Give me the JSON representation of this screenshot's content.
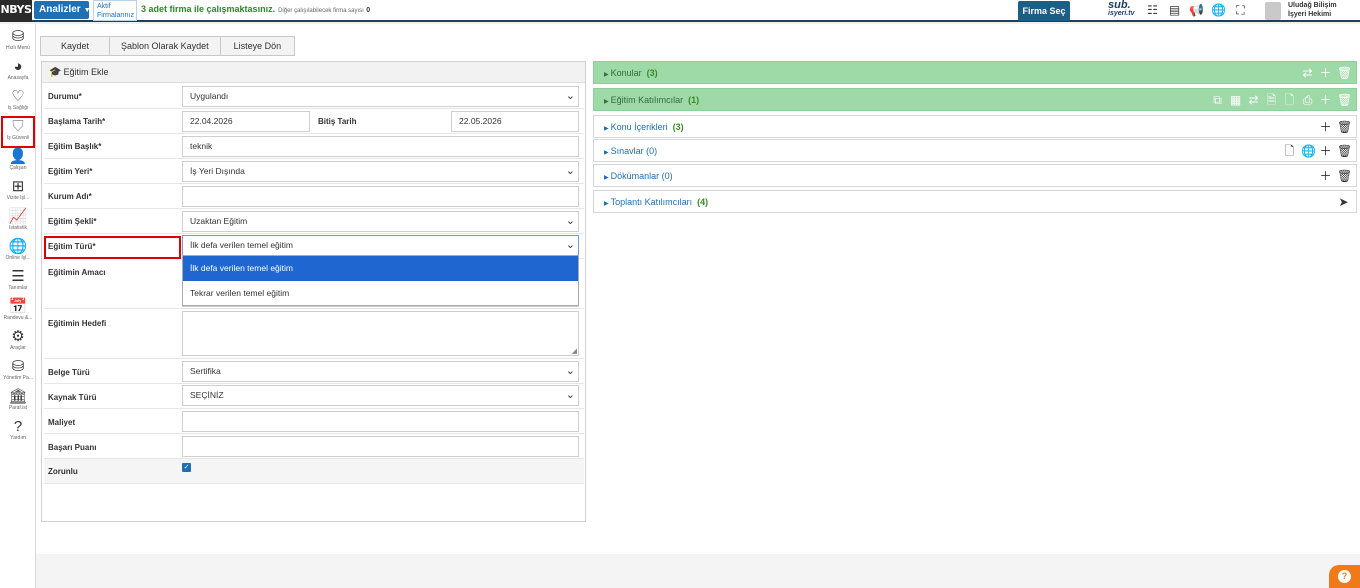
{
  "topbar": {
    "logo": "NBYS",
    "analiz_label": "Analizler",
    "aktif_label": "Aktif Firmalarınız",
    "firm_message": "3 adet firma ile çalışmaktasınız.",
    "other_firms_label": "Diğer çalışılabilecek firma sayısı",
    "other_firms_count": "0",
    "firma_sec_label": "Firma Seç",
    "sub_logo_top": "sub.",
    "sub_logo_bottom": "isyeri.tv",
    "user_name_line1": "Uludağ Bilişim",
    "user_name_line2": "İşyeri Hekimi"
  },
  "sidebar": {
    "items": [
      {
        "label": "Hızlı Menü",
        "icon": "cubes-icon"
      },
      {
        "label": "Anasayfa",
        "icon": "pie-chart-icon"
      },
      {
        "label": "İş Sağlığı",
        "icon": "heartbeat-icon"
      },
      {
        "label": "İş Güvenli",
        "icon": "shield-icon"
      },
      {
        "label": "Çalışan",
        "icon": "user-icon"
      },
      {
        "label": "Vizite İşl...",
        "icon": "medical-kit-icon"
      },
      {
        "label": "İstatistik",
        "icon": "line-chart-icon"
      },
      {
        "label": "Online İşl...",
        "icon": "globe-icon"
      },
      {
        "label": "Tanımlar",
        "icon": "sliders-icon"
      },
      {
        "label": "Randevu &...",
        "icon": "calendar-icon"
      },
      {
        "label": "Araçlar",
        "icon": "cogs-icon"
      },
      {
        "label": "Yönetim Pa...",
        "icon": "cubes-icon"
      },
      {
        "label": "Paraf.ist",
        "icon": "bank-icon"
      },
      {
        "label": "Yardım",
        "icon": "question-icon"
      }
    ]
  },
  "toolbar": {
    "save": "Kaydet",
    "save_template": "Şablon Olarak Kaydet",
    "back_to_list": "Listeye Dön"
  },
  "form": {
    "title": "Eğitim Ekle",
    "durumu_label": "Durumu*",
    "durumu_value": "Uygulandı",
    "baslama_label": "Başlama Tarih*",
    "baslama_value": "22.04.2026",
    "bitis_label": "Bitiş Tarih",
    "bitis_value": "22.05.2026",
    "baslik_label": "Eğitim Başlık*",
    "baslik_value": "teknik",
    "yeri_label": "Eğitim Yeri*",
    "yeri_value": "İş Yeri Dışında",
    "kurum_label": "Kurum Adı*",
    "kurum_value": "",
    "sekli_label": "Eğitim Şekli*",
    "sekli_value": "Uzaktan Eğitim",
    "turu_label": "Eğitim Türü*",
    "turu_value": "İlk defa verilen temel eğitim",
    "amaci_label": "Eğitimin Amacı",
    "hedefi_label": "Eğitimin Hedefi",
    "belge_label": "Belge Türü",
    "belge_value": "Sertifika",
    "kaynak_label": "Kaynak Türü",
    "kaynak_value": "SEÇİNİZ",
    "maliyet_label": "Maliyet",
    "maliyet_value": "",
    "basari_label": "Başarı Puanı",
    "basari_value": "",
    "zorunlu_label": "Zorunlu",
    "zorunlu_checked": true
  },
  "dropdown": {
    "options": [
      "İlk defa verilen temel eğitim",
      "Tekrar verilen temel eğitim"
    ],
    "selected_index": 0
  },
  "right_panels": [
    {
      "title": "Konular",
      "count": "(3)",
      "style": "green",
      "icons": [
        "exchange-icon",
        "plus-icon",
        "trash-icon"
      ]
    },
    {
      "title": "Eğitim Katılımcılar",
      "count": "(1)",
      "style": "green",
      "icons": [
        "copy-icon",
        "table-icon",
        "exchange-icon",
        "excel-icon",
        "pdf-icon",
        "print-icon",
        "plus-icon",
        "trash-icon"
      ]
    },
    {
      "title": "Konu İçerikleri",
      "count": "(3)",
      "style": "white",
      "icons": [
        "plus-icon",
        "trash-icon"
      ]
    },
    {
      "title": "Sınavlar (0)",
      "count": "",
      "style": "white",
      "icons": [
        "pdf-icon",
        "globe-icon",
        "plus-icon",
        "trash-icon"
      ]
    },
    {
      "title": "Dökümanlar (0)",
      "count": "",
      "style": "white",
      "icons": [
        "plus-icon",
        "trash-icon"
      ]
    },
    {
      "title": "Toplantı Katılımcıları",
      "count": "(4)",
      "style": "white",
      "icons": [
        "send-icon"
      ]
    }
  ],
  "colors": {
    "accent": "#1f6fb2",
    "green_panel": "#9ed9a8",
    "dropdown_selected": "#1f66d1",
    "highlight": "#e10000",
    "help": "#f07a1a"
  }
}
